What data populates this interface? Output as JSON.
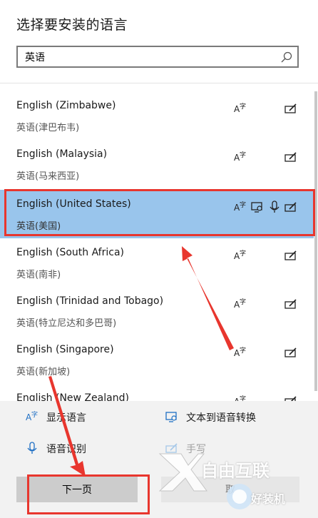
{
  "dialog": {
    "title": "选择要安装的语言"
  },
  "search": {
    "value": "英语"
  },
  "languages": [
    {
      "name": "English (Zimbabwe)",
      "native": "英语(津巴布韦)"
    },
    {
      "name": "English (Malaysia)",
      "native": "英语(马来西亚)"
    },
    {
      "name": "English (United States)",
      "native": "英语(美国)",
      "selected": true
    },
    {
      "name": "English (South Africa)",
      "native": "英语(南非)"
    },
    {
      "name": "English (Trinidad and Tobago)",
      "native": "英语(特立尼达和多巴哥)"
    },
    {
      "name": "English (Singapore)",
      "native": "英语(新加坡)"
    },
    {
      "name": "English (New Zealand)",
      "native": ""
    }
  ],
  "features": {
    "display_language": "显示语言",
    "text_to_speech": "文本到语音转换",
    "speech_recognition": "语音识别",
    "handwriting": "手写"
  },
  "buttons": {
    "next": "下一页",
    "cancel": "取"
  },
  "watermark": {
    "brand": "自由互联",
    "sub": "好装机"
  },
  "colors": {
    "selection": "#99c5ec",
    "annotation_red": "#e8362e",
    "feature_bg": "#f2f2f2"
  }
}
